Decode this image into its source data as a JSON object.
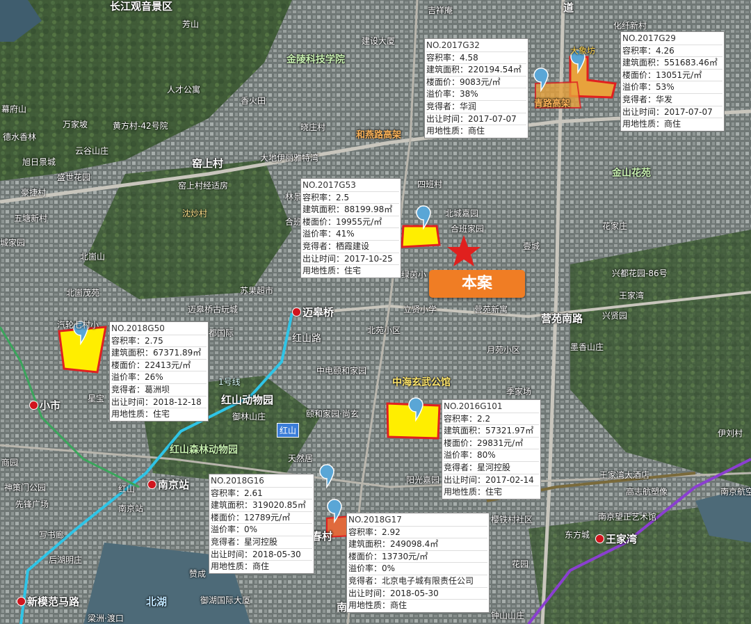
{
  "colors": {
    "parcel_fill": "#ffee00",
    "parcel_stroke": "#e02020",
    "pin": "#5aa6d6",
    "star": "#e0201e",
    "benan_bg": "#f07d24",
    "metro_line1": "#2fc4e6",
    "metro_line": "#8a3fd0"
  },
  "marker": {
    "label": "本案"
  },
  "labels": {
    "l1": "长江观音景区",
    "l2": "吉祥庵",
    "l3": "化纤新村",
    "l4": "芳山",
    "l5": "建设大厦",
    "l6": "金陵科技学院",
    "l7": "大象坊",
    "l8": "人才公寓",
    "l9": "香火田",
    "l10": "幕府山",
    "l11": "万家坡",
    "l12": "黄方村-42号院",
    "l13": "德水香林",
    "l14": "晓庄村",
    "l15": "和燕路高架",
    "l16": "云谷山庄",
    "l17": "旭日景城",
    "l18": "大地伊丽雅特湾",
    "l19": "窑上村",
    "l20": "金山花苑",
    "l21": "盛世花园",
    "l22": "窑上村经适房",
    "l23": "四班村",
    "l24": "豪捷村",
    "l25": "林景",
    "l26": "北城嘉园",
    "l27": "五塘新村",
    "l28": "沈炒村",
    "l29": "合班",
    "l30": "合班家园",
    "l31": "花家庄",
    "l32": "壹城",
    "l33": "城家园",
    "l34": "北崮山",
    "l35": "绿茵小",
    "l36": "兴都花园-86号",
    "l37": "北崮茂苑",
    "l38": "苏果超市",
    "l39": "王家湾",
    "l40": "迈皋桥古玩城",
    "l41": "迈皋桥",
    "l42": "立贤小学",
    "l43": "营苑新寓",
    "l44": "营苑南路",
    "l45": "兴贤园",
    "l46": "汽轮七村小",
    "l47": "都国际",
    "l48": "北苑小区",
    "l49": "月苑小区",
    "l50": "墨香山庄",
    "l51": "红山路",
    "l52": "中电颐和家园",
    "l53": "中海玄武公馆",
    "l54": "季家场",
    "l55": "1号线",
    "l56": "红山动物园",
    "l57": "小市",
    "l58": "星宝",
    "l59": "颐和家园·尚玄",
    "l60": "御林山庄",
    "l61": "红山",
    "l62": "红山森林动物园",
    "l63": "天然居",
    "l64": "商园",
    "l65": "神策门公园",
    "l66": "先锋广场",
    "l67": "南京站",
    "l68": "红山",
    "l69": "阳光嘉园",
    "l70": "伊刘村",
    "l71": "王家湾大酒店",
    "l72": "高志航塑像",
    "l73": "南京航空",
    "l74": "写书廊",
    "l75": "南京站",
    "l76": "南京望正艺术馆",
    "l77": "樱铁村社区",
    "l78": "后湖明庄",
    "l79": "春村",
    "l80": "东方城",
    "l81": "王家湾",
    "l82": "花园",
    "l83": "赞成",
    "l84": "御湖国际大厦",
    "l85": "新模范马路",
    "l86": "北湖",
    "l87": "梁洲·渡口",
    "l88": "南",
    "l89": "钟山山庄",
    "l90": "青路高架",
    "l91": "道"
  },
  "parcels": [
    {
      "lines": [
        "NO.2017G32",
        "容积率：4.58",
        "建筑面积：220194.54㎡",
        "楼面价：9083元/㎡",
        "溢价率：38%",
        "竞得者：华润",
        "出让时间：2017-07-07",
        "用地性质：商住"
      ]
    },
    {
      "lines": [
        "NO.2017G29",
        "容积率：4.26",
        "建筑面积：551683.46㎡",
        "楼面价：13051元/㎡",
        "溢价率：53%",
        "竞得者：华发",
        "出让时间：2017-07-07",
        "用地性质：商住"
      ]
    },
    {
      "lines": [
        "NO.2017G53",
        "容积率：2.5",
        "建筑面积：88199.98㎡",
        "楼面价：19955元/㎡",
        "溢价率：41%",
        "竞得者：栖霞建设",
        "出让时间：2017-10-25",
        "用地性质：住宅"
      ]
    },
    {
      "lines": [
        "NO.2018G50",
        "容积率：2.75",
        "建筑面积：67371.89㎡",
        "楼面价：22413元/㎡",
        "溢价率：26%",
        "竞得者：葛洲坝",
        "出让时间：2018-12-18",
        "用地性质：住宅"
      ]
    },
    {
      "lines": [
        "NO.2016G101",
        "容积率：2.2",
        "建筑面积：57321.97㎡",
        "楼面价：29831元/㎡",
        "溢价率：80%",
        "竞得者：星河控股",
        "出让时间：2017-02-14",
        "用地性质：住宅"
      ]
    },
    {
      "lines": [
        "NO.2018G16",
        "容积率：2.61",
        "建筑面积：319020.85㎡",
        "楼面价：12789元/㎡",
        "溢价率：0%",
        "竞得者：星河控股",
        "出让时间：2018-05-30",
        "用地性质：商住"
      ]
    },
    {
      "lines": [
        "NO.2018G17",
        "容积率：2.92",
        "建筑面积：249098.4㎡",
        "楼面价：13730元/㎡",
        "溢价率：0%",
        "竞得者：北京电子城有限责任公司",
        "出让时间：2018-05-30",
        "用地性质：商住"
      ]
    }
  ]
}
